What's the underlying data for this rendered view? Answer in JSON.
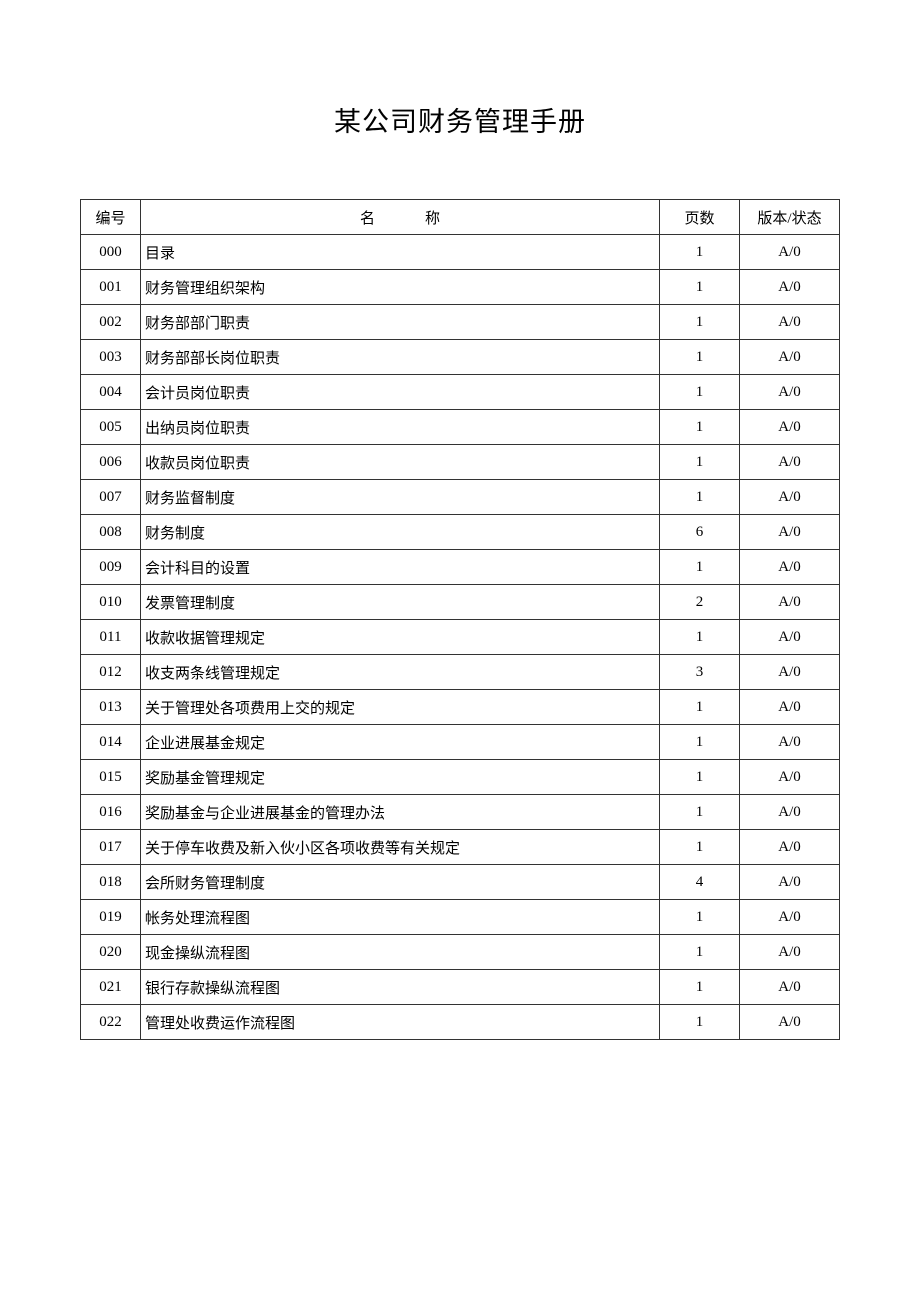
{
  "title": "某公司财务管理手册",
  "headers": {
    "num": "编号",
    "name": "名称",
    "pages": "页数",
    "version": "版本/状态"
  },
  "rows": [
    {
      "num": "000",
      "name": "目录",
      "pages": "1",
      "version": "A/0"
    },
    {
      "num": "001",
      "name": "财务管理组织架构",
      "pages": "1",
      "version": "A/0"
    },
    {
      "num": "002",
      "name": "财务部部门职责",
      "pages": "1",
      "version": "A/0"
    },
    {
      "num": "003",
      "name": "财务部部长岗位职责",
      "pages": "1",
      "version": "A/0"
    },
    {
      "num": "004",
      "name": "会计员岗位职责",
      "pages": "1",
      "version": "A/0"
    },
    {
      "num": "005",
      "name": "出纳员岗位职责",
      "pages": "1",
      "version": "A/0"
    },
    {
      "num": "006",
      "name": "收款员岗位职责",
      "pages": "1",
      "version": "A/0"
    },
    {
      "num": "007",
      "name": "财务监督制度",
      "pages": "1",
      "version": "A/0"
    },
    {
      "num": "008",
      "name": "财务制度",
      "pages": "6",
      "version": "A/0"
    },
    {
      "num": "009",
      "name": "会计科目的设置",
      "pages": "1",
      "version": "A/0"
    },
    {
      "num": "010",
      "name": "发票管理制度",
      "pages": "2",
      "version": "A/0"
    },
    {
      "num": "011",
      "name": "收款收据管理规定",
      "pages": "1",
      "version": "A/0"
    },
    {
      "num": "012",
      "name": "收支两条线管理规定",
      "pages": "3",
      "version": "A/0"
    },
    {
      "num": "013",
      "name": "关于管理处各项费用上交的规定",
      "pages": "1",
      "version": "A/0"
    },
    {
      "num": "014",
      "name": "企业进展基金规定",
      "pages": "1",
      "version": "A/0"
    },
    {
      "num": "015",
      "name": "奖励基金管理规定",
      "pages": "1",
      "version": "A/0"
    },
    {
      "num": "016",
      "name": "奖励基金与企业进展基金的管理办法",
      "pages": "1",
      "version": "A/0"
    },
    {
      "num": "017",
      "name": "关于停车收费及新入伙小区各项收费等有关规定",
      "pages": "1",
      "version": "A/0"
    },
    {
      "num": "018",
      "name": "会所财务管理制度",
      "pages": "4",
      "version": "A/0"
    },
    {
      "num": "019",
      "name": "帐务处理流程图",
      "pages": "1",
      "version": "A/0"
    },
    {
      "num": "020",
      "name": "现金操纵流程图",
      "pages": "1",
      "version": "A/0"
    },
    {
      "num": "021",
      "name": "银行存款操纵流程图",
      "pages": "1",
      "version": "A/0"
    },
    {
      "num": "022",
      "name": "管理处收费运作流程图",
      "pages": "1",
      "version": "A/0"
    }
  ]
}
